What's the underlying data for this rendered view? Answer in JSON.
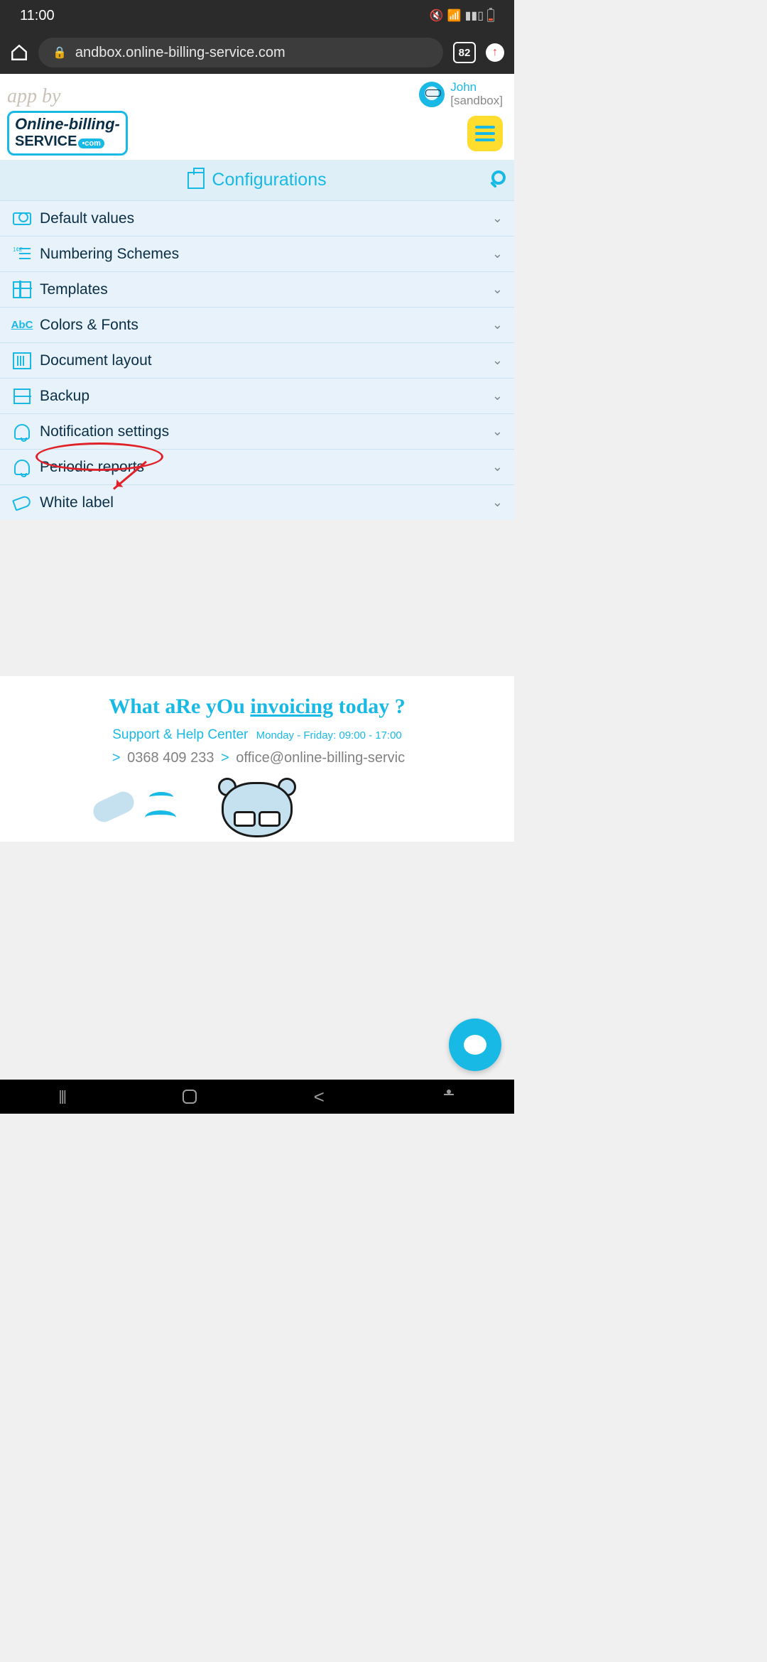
{
  "status": {
    "time": "11:00"
  },
  "browser": {
    "url": "andbox.online-billing-service.com",
    "tab_count": "82"
  },
  "header": {
    "app_by": "app by",
    "user_name": "John",
    "user_sub": "[sandbox]"
  },
  "logo": {
    "line1": "Online-billing-",
    "line2": "SERVICE",
    "dotcom": "•com"
  },
  "section": {
    "title": "Configurations"
  },
  "rows": [
    {
      "label": "Default values"
    },
    {
      "label": "Numbering Schemes"
    },
    {
      "label": "Templates"
    },
    {
      "label": "Colors & Fonts"
    },
    {
      "label": "Document layout"
    },
    {
      "label": "Backup"
    },
    {
      "label": "Notification settings"
    },
    {
      "label": "Periodic reports"
    },
    {
      "label": "White label"
    }
  ],
  "footer": {
    "tagline_pre": "What aRe yOu ",
    "tagline_em": "invoicing",
    "tagline_post": " today ?",
    "support": "Support & Help Center",
    "hours": "Monday - Friday: 09:00 - 17:00",
    "phone": "0368 409 233",
    "email": "office@online-billing-servic"
  }
}
